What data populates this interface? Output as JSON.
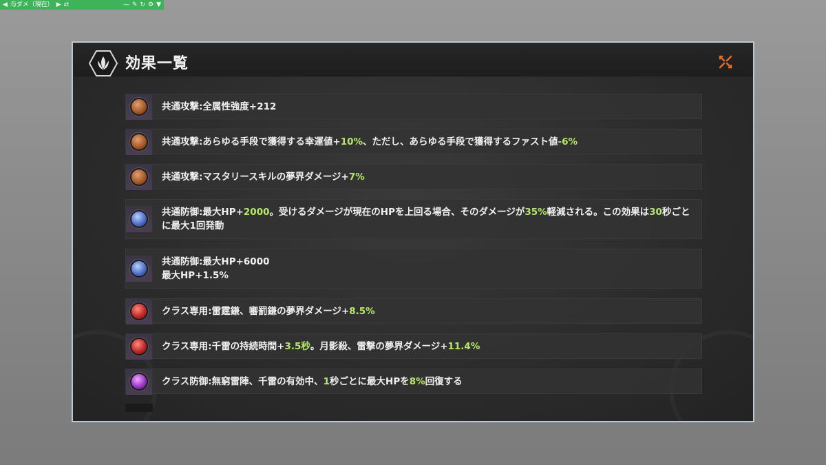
{
  "overlay": {
    "label": "与ダメ（現在）"
  },
  "dialog": {
    "title": "効果一覧"
  },
  "effects": [
    {
      "orb": "orange",
      "parts": [
        {
          "t": "共通攻撃:全属性強度+212"
        }
      ]
    },
    {
      "orb": "orange",
      "parts": [
        {
          "t": "共通攻撃:あらゆる手段で獲得する幸運値+"
        },
        {
          "t": "10%",
          "hl": true
        },
        {
          "t": "、ただし、あらゆる手段で獲得するファスト値"
        },
        {
          "t": "-6%",
          "hl": true
        }
      ]
    },
    {
      "orb": "orange",
      "parts": [
        {
          "t": "共通攻撃:マスタリースキルの夢界ダメージ+"
        },
        {
          "t": "7%",
          "hl": true
        }
      ]
    },
    {
      "orb": "blue",
      "tall": true,
      "parts": [
        {
          "t": "共通防御:最大HP+"
        },
        {
          "t": "2000",
          "hl": true
        },
        {
          "t": "。受けるダメージが現在のHPを上回る場合、そのダメージが"
        },
        {
          "t": "35%",
          "hl": true
        },
        {
          "t": "軽減される。この効果は"
        },
        {
          "t": "30",
          "hl": true
        },
        {
          "t": "秒ごとに最大1回発動"
        }
      ]
    },
    {
      "orb": "blue",
      "tall": true,
      "parts": [
        {
          "t": "共通防御:最大HP+6000"
        },
        {
          "br": true
        },
        {
          "t": "最大HP+1.5%"
        }
      ]
    },
    {
      "orb": "red",
      "parts": [
        {
          "t": "クラス専用:雷霆鎌、審罰鎌の夢界ダメージ+"
        },
        {
          "t": "8.5%",
          "hl": true
        }
      ]
    },
    {
      "orb": "red",
      "parts": [
        {
          "t": "クラス専用:千雷の持続時間+"
        },
        {
          "t": "3.5秒",
          "hl": true
        },
        {
          "t": "。月影殺、雷撃の夢界ダメージ+"
        },
        {
          "t": "11.4%",
          "hl": true
        }
      ]
    },
    {
      "orb": "purple",
      "parts": [
        {
          "t": "クラス防御:無窮雷陣、千雷の有効中、"
        },
        {
          "t": "1",
          "hl": true
        },
        {
          "t": "秒ごとに最大HPを"
        },
        {
          "t": "8%",
          "hl": true
        },
        {
          "t": "回復する"
        }
      ]
    }
  ],
  "colors": {
    "highlight": "#b6e86a",
    "close": "#e86a20",
    "overlay_bar": "#3fb35a"
  }
}
